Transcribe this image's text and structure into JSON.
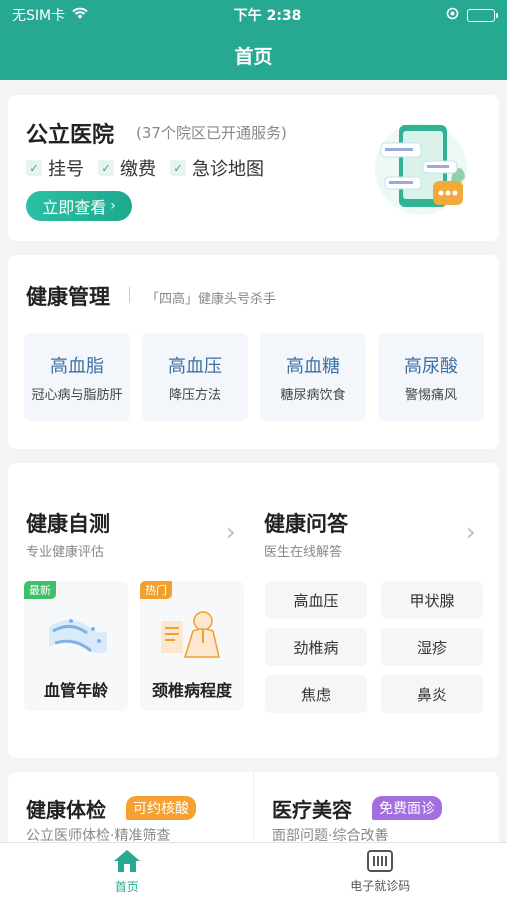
{
  "status_bar": {
    "carrier": "无SIM卡",
    "time": "下午 2:38"
  },
  "nav": {
    "title": "首页"
  },
  "hospital": {
    "title": "公立医院",
    "subtitle": "(37个院区已开通服务)",
    "checks": [
      "挂号",
      "缴费",
      "急诊地图"
    ],
    "button": "立即查看"
  },
  "health_mgmt": {
    "title": "健康管理",
    "subtitle": "「四高」健康头号杀手",
    "items": [
      {
        "name": "高血脂",
        "desc": "冠心病与脂肪肝"
      },
      {
        "name": "高血压",
        "desc": "降压方法"
      },
      {
        "name": "高血糖",
        "desc": "糖尿病饮食"
      },
      {
        "name": "高尿酸",
        "desc": "警惕痛风"
      }
    ]
  },
  "self_test": {
    "title": "健康自测",
    "subtitle": "专业健康评估",
    "tiles": [
      {
        "tag": "最新",
        "label": "血管年龄"
      },
      {
        "tag": "热门",
        "label": "颈椎病程度"
      }
    ]
  },
  "qa": {
    "title": "健康问答",
    "subtitle": "医生在线解答",
    "tags": [
      "高血压",
      "甲状腺",
      "劲椎病",
      "湿疹",
      "焦虑",
      "鼻炎"
    ]
  },
  "checkup": {
    "title": "健康体检",
    "badge": "可约核酸",
    "subtitle": "公立医师体检·精准筛查"
  },
  "beauty": {
    "title": "医疗美容",
    "badge": "免费面诊",
    "subtitle": "面部问题·综合改善"
  },
  "tabs": [
    {
      "label": "首页"
    },
    {
      "label": "电子就诊码"
    }
  ],
  "colors": {
    "brand": "#26a891",
    "tag_new": "#3fbf6a",
    "tag_hot": "#f0a030",
    "badge_orange": "#f5a030",
    "badge_purple": "#a36ee0"
  }
}
